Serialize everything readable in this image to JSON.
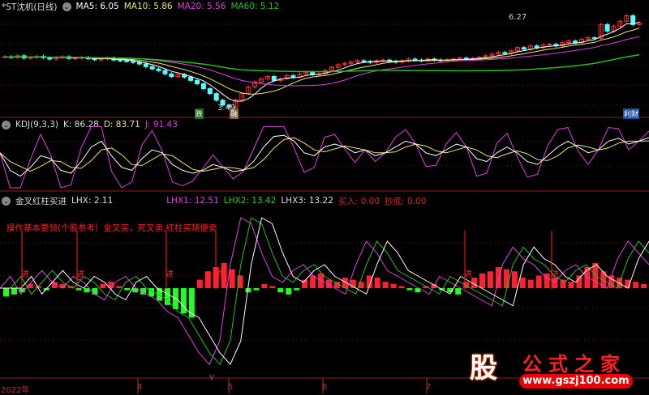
{
  "main": {
    "title": "*ST沈机(日线)",
    "ma5": "MA5: 6.05",
    "ma10": "MA10: 5.86",
    "ma20": "MA20: 5.56",
    "ma60": "MA60: 5.12",
    "high_label": "6.27",
    "low_label": "3.49",
    "tags": [
      "跌",
      "融",
      "利财"
    ]
  },
  "kdj": {
    "title": "KDJ(9,3,3)",
    "k": "K: 86.28",
    "d": "D: 83.71",
    "j": "J: 91.43"
  },
  "lhx": {
    "title": "金叉红柱买进",
    "lhx": "LHX: 2.11",
    "lhx1": "LHX1: 12.51",
    "lhx2": "LHX2: 13.42",
    "lhx3": "LHX3: 13.22",
    "buy": "买入: 0.00",
    "bottom": "抄底: 0.00",
    "note": "操作基本要领(个股参考）金叉买，死叉卖,红柱买随便卖",
    "entry_label": "进"
  },
  "axis": {
    "labels": [
      "2022年",
      "4",
      "5",
      "6",
      "7"
    ],
    "marker": "V"
  },
  "watermark": {
    "icon": "股",
    "brand": "公式之家",
    "url": "www.gszj100.com"
  },
  "colors": {
    "up": "#ff3232",
    "down": "#54ffff",
    "ma5": "#ffffff",
    "ma10": "#e8e870",
    "ma20": "#e040e0",
    "ma60": "#20c020",
    "grid": "#8b0000"
  },
  "chart_data": {
    "type": "candlestick",
    "close": [
      5.02,
      5.0,
      5.05,
      4.98,
      5.0,
      5.03,
      4.99,
      4.95,
      5.0,
      5.02,
      4.97,
      4.98,
      5.0,
      4.96,
      4.93,
      4.95,
      4.98,
      4.92,
      4.9,
      4.88,
      4.85,
      4.8,
      4.72,
      4.65,
      4.6,
      4.5,
      4.42,
      4.48,
      4.4,
      4.3,
      4.2,
      4.05,
      3.9,
      3.7,
      3.55,
      3.49,
      3.7,
      3.9,
      4.1,
      4.25,
      4.35,
      4.42,
      4.3,
      4.35,
      4.45,
      4.4,
      4.5,
      4.55,
      4.48,
      4.5,
      4.6,
      4.7,
      4.78,
      4.82,
      4.86,
      4.9,
      4.88,
      4.85,
      4.9,
      4.92,
      4.88,
      4.86,
      4.9,
      4.95,
      4.92,
      4.9,
      4.95,
      4.92,
      4.9,
      4.93,
      4.95,
      4.98,
      4.95,
      4.97,
      5.0,
      5.05,
      5.1,
      5.15,
      5.12,
      5.2,
      5.3,
      5.25,
      5.35,
      5.3,
      5.38,
      5.4,
      5.35,
      5.45,
      5.5,
      5.45,
      5.55,
      5.6,
      5.58,
      6.0,
      5.8,
      5.95,
      6.1,
      6.27,
      6.0,
      6.05
    ],
    "kdj_k": [
      60,
      30,
      20,
      35,
      55,
      50,
      30,
      25,
      45,
      70,
      80,
      55,
      35,
      30,
      50,
      65,
      60,
      40,
      30,
      25,
      30,
      40,
      35,
      28,
      30,
      45,
      70,
      88,
      90,
      80,
      60,
      55,
      70,
      75,
      70,
      60,
      65,
      55,
      60,
      70,
      80,
      75,
      60,
      55,
      65,
      75,
      70,
      50,
      45,
      60,
      70,
      60,
      45,
      40,
      55,
      70,
      80,
      70,
      60,
      65,
      80,
      85,
      75,
      80,
      86
    ],
    "lhx_bar": [
      -4,
      -3,
      -2,
      2,
      1,
      -1,
      3,
      2,
      1,
      -1,
      -2,
      -3,
      2,
      3,
      1,
      -1,
      -2,
      -3,
      -4,
      -6,
      -8,
      -10,
      -12,
      -14,
      4,
      8,
      10,
      12,
      9,
      6,
      -2,
      -1,
      2,
      1,
      -2,
      -3,
      -1,
      4,
      6,
      7,
      4,
      3,
      5,
      4,
      3,
      6,
      5,
      3,
      2,
      1,
      -1,
      -2,
      1,
      2,
      -1,
      -2,
      -3,
      3,
      5,
      7,
      8,
      10,
      9,
      8,
      5,
      4,
      6,
      7,
      5,
      4,
      3,
      6,
      10,
      12,
      8,
      6,
      5,
      4,
      3,
      2
    ],
    "lhx1": [
      0,
      10,
      -5,
      5,
      15,
      5,
      0,
      10,
      5,
      -5,
      -10,
      5,
      10,
      0,
      -5,
      -10,
      -20,
      -25,
      -40,
      -55,
      -65,
      -45,
      20,
      60,
      55,
      30,
      10,
      5,
      15,
      20,
      10,
      5,
      0,
      -5,
      20,
      40,
      30,
      15,
      10,
      5,
      0,
      -5,
      10,
      5,
      0,
      -5,
      -10,
      -15,
      20,
      35,
      25,
      20,
      10,
      5,
      15,
      20,
      10,
      5,
      0,
      25,
      40,
      30,
      20
    ]
  }
}
